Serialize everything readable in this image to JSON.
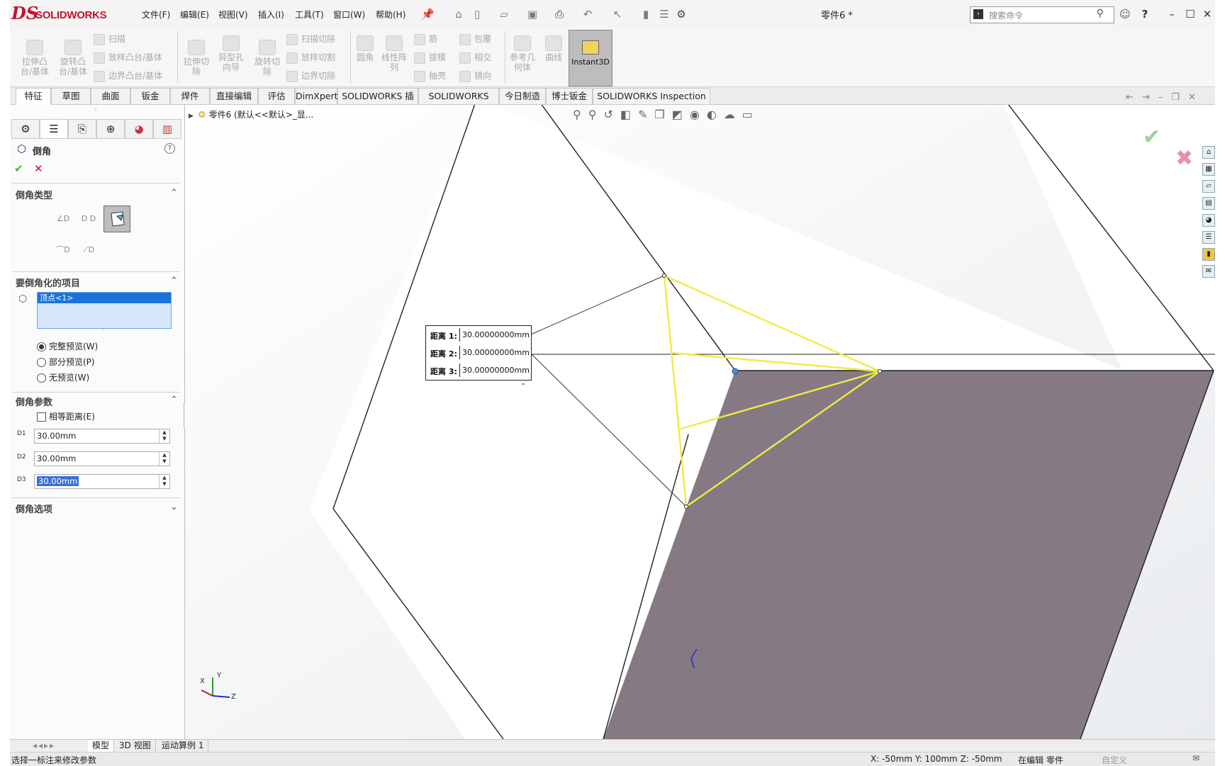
{
  "app": {
    "logo_ds": "DS",
    "logo_name": "SOLIDWORKS",
    "doc_title": "零件6 *"
  },
  "menu": [
    "文件(F)",
    "编辑(E)",
    "视图(V)",
    "插入(I)",
    "工具(T)",
    "窗口(W)",
    "帮助(H)"
  ],
  "search": {
    "placeholder": "搜索命令"
  },
  "commands": {
    "extrude_boss": "拉伸凸台/基体",
    "revolve_boss": "旋转凸台/基体",
    "sweep": "扫描",
    "loft_boss": "放样凸台/基体",
    "boundary_boss": "边界凸台/基体",
    "extrude_cut": "拉伸切除",
    "hole_wizard": "异型孔向导",
    "revolve_cut": "旋转切除",
    "swept_cut": "扫描切除",
    "lofted_cut": "放样切割",
    "boundary_cut": "边界切除",
    "fillet": "圆角",
    "linear_pattern": "线性阵列",
    "rib": "筋",
    "draft": "拔模",
    "shell": "抽壳",
    "wrap": "包覆",
    "intersect": "相交",
    "mirror": "镜向",
    "ref_geometry": "参考几何体",
    "curves": "曲线",
    "instant3d": "Instant3D"
  },
  "tabs": [
    "特征",
    "草图",
    "曲面",
    "钣金",
    "焊件",
    "直接编辑",
    "评估",
    "DimXpert",
    "SOLIDWORKS 插件",
    "SOLIDWORKS MBD",
    "今日制造",
    "博士钣金",
    "SOLIDWORKS Inspection"
  ],
  "active_tab": "特征",
  "tree_label": "零件6 (默认<<默认>_显...",
  "property_manager": {
    "title": "倒角",
    "help": "?",
    "ok": "✔",
    "cancel": "✕",
    "chamfer_type_title": "倒角类型",
    "items_title": "要倒角化的项目",
    "selection_item": "顶点<1>",
    "preview_full": "完整预览(W)",
    "preview_partial": "部分预览(P)",
    "preview_none": "无预览(W)",
    "params_title": "倒角参数",
    "equal_distance": "相等距离(E)",
    "d1_value": "30.00mm",
    "d2_value": "30.00mm",
    "d3_value": "30.00mm",
    "d1_label": "D1",
    "d2_label": "D2",
    "d3_label": "D3",
    "options_title": "倒角选项"
  },
  "callout": {
    "rows": [
      {
        "label": "距离 1:",
        "value": "30.00000000mm"
      },
      {
        "label": "距离 2:",
        "value": "30.00000000mm"
      },
      {
        "label": "距离 3:",
        "value": "30.00000000mm"
      }
    ]
  },
  "triad": {
    "x": "X",
    "y": "Y",
    "z": "Z"
  },
  "bottom_tabs": [
    "模型",
    "3D 视图",
    "运动算例 1"
  ],
  "status": {
    "hint": "选择一标注来修改参数",
    "coords": "X: -50mm Y: 100mm Z: -50mm",
    "mode": "在编辑 零件",
    "units": "自定义"
  },
  "colors": {
    "face_dark": "#857a83",
    "preview_yellow": "#f1ea44",
    "accent_red": "#c8102e",
    "ok_green": "#3fae49",
    "selection_blue": "#1a73d9"
  }
}
